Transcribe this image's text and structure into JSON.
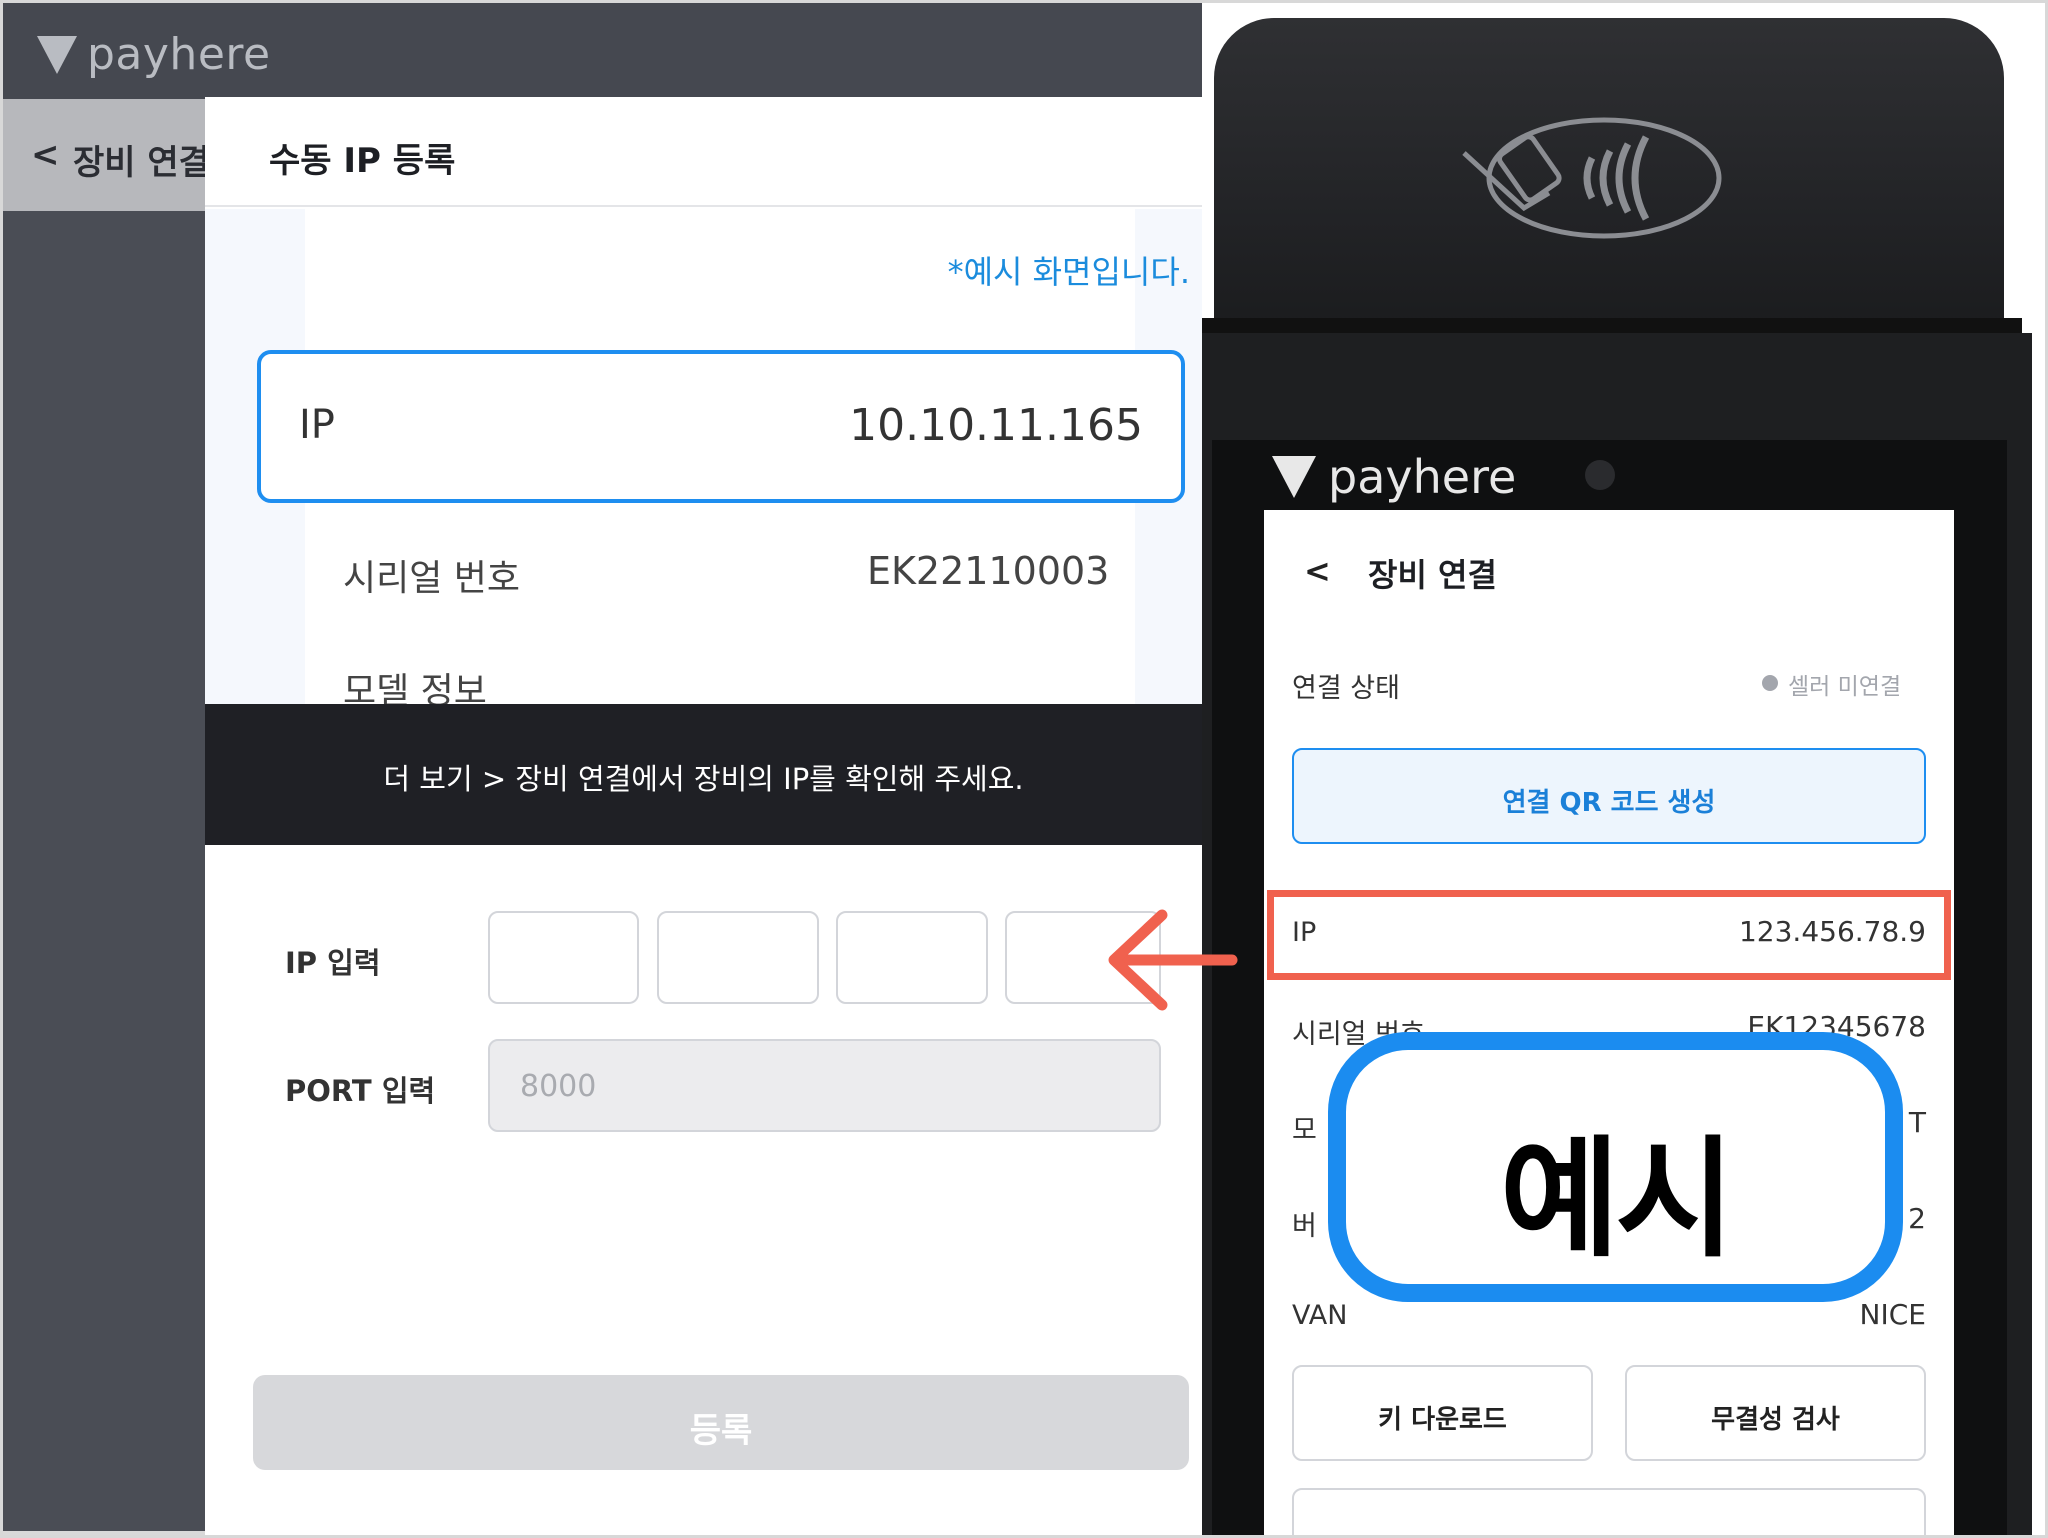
{
  "app": {
    "logo_text": "payhere",
    "subbar_back": "<",
    "subbar_title": "장비 연결"
  },
  "modal": {
    "title": "수동 IP 등록",
    "preview": {
      "note": "*예시 화면입니다.",
      "ip_label": "IP",
      "ip_value": "10.10.11.165",
      "serial_label": "시리얼 번호",
      "serial_value": "EK22110003",
      "model_label": "모델 정보"
    },
    "banner": "더 보기 > 장비 연결에서 장비의 IP를 확인해 주세요.",
    "ip_input_label": "IP 입력",
    "ip_octets": [
      "",
      "",
      "",
      ""
    ],
    "port_label": "PORT 입력",
    "port_value": "8000",
    "submit_label": "등록"
  },
  "device": {
    "logo_text": "payhere",
    "screen": {
      "back": "<",
      "title": "장비 연결",
      "status_label": "연결 상태",
      "status_value": "셀러 미연결",
      "qr_button": "연결 QR 코드 생성",
      "ip_label": "IP",
      "ip_value": "123.456.78.9",
      "serial_label_partial": "시리얼 번호",
      "serial_value_partial": "EK12345678",
      "model_label_partial": "모",
      "model_value_partial": "T",
      "version_label_partial": "버",
      "version_value_partial": "2",
      "van_label": "VAN",
      "van_value": "NICE",
      "key_download": "키 다운로드",
      "integrity_check": "무결성 검사"
    }
  },
  "overlay": {
    "example_label": "예시",
    "arrow_color": "#f0614e",
    "stamp_color": "#1b8cf0"
  },
  "colors": {
    "accent_blue": "#1e8ef0",
    "highlight_red": "#f0614e",
    "banner_dark": "#1f2025"
  }
}
